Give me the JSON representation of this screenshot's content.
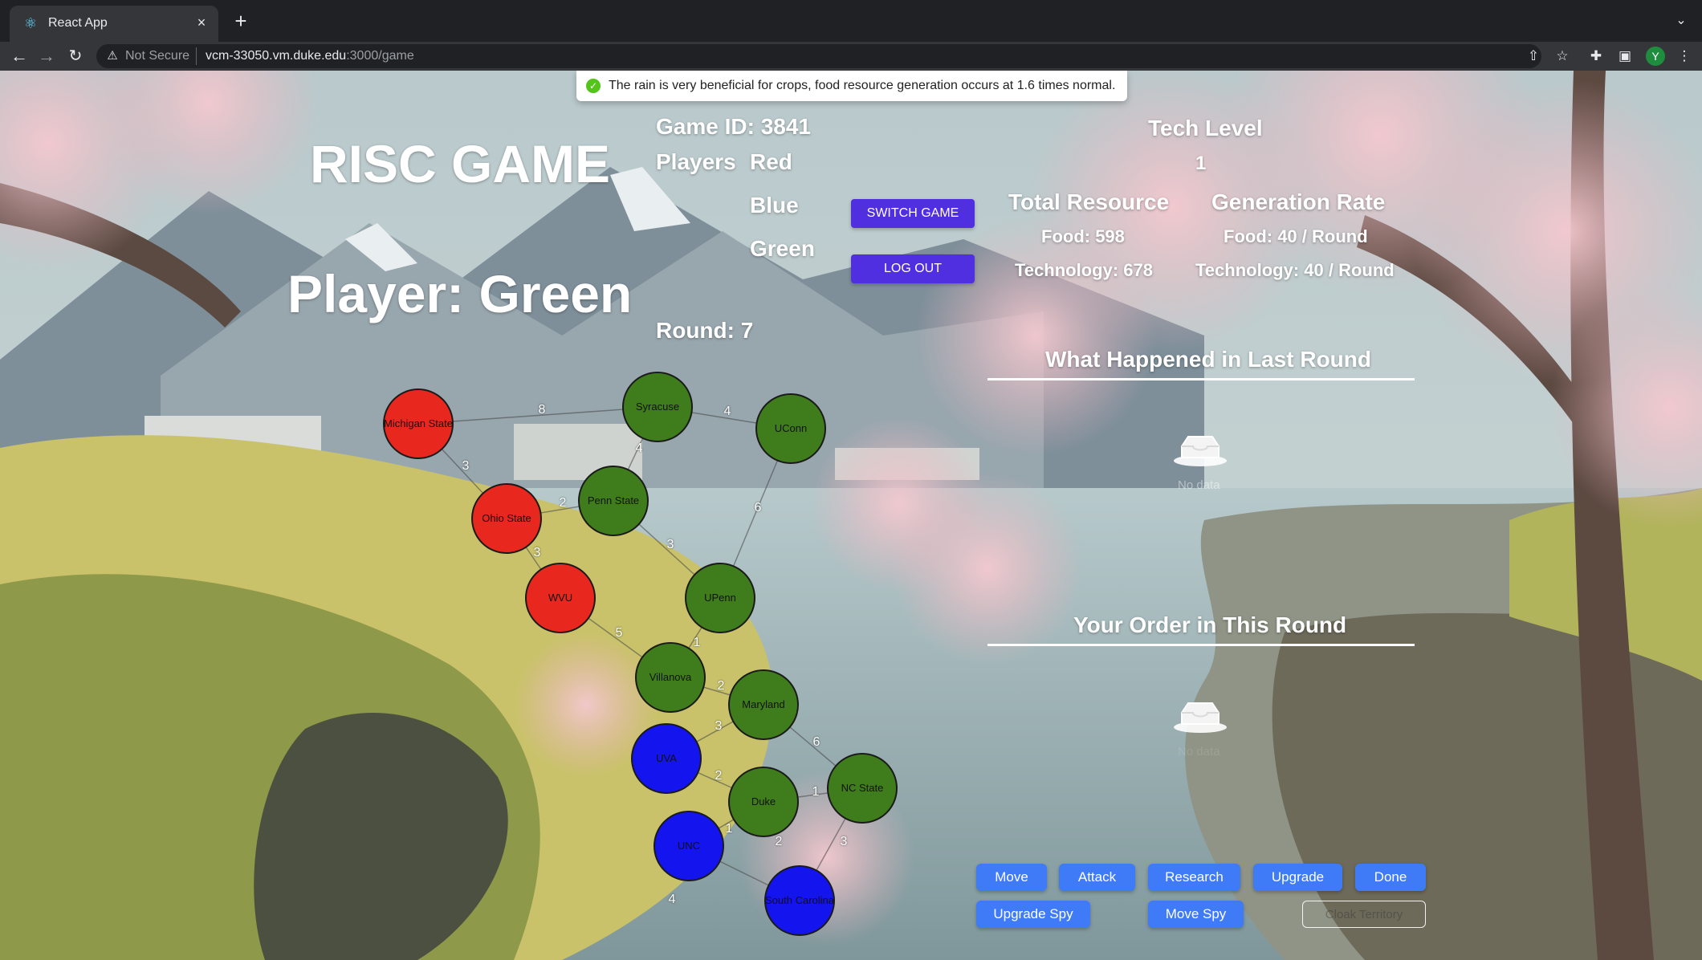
{
  "browser": {
    "tab_title": "React App",
    "tab_close": "×",
    "new_tab": "+",
    "security_label": "Not Secure",
    "url_host": "vcm-33050.vm.duke.edu",
    "url_path": ":3000/game",
    "profile_initial": "Y"
  },
  "toast": {
    "message": "The rain is very beneficial for crops, food resource generation occurs at 1.6 times normal.",
    "status_color": "#52c41a"
  },
  "header": {
    "game_title": "RISC GAME",
    "player_heading": "Player: Green",
    "game_id": "Game ID: 3841",
    "players_label": "Players",
    "players": [
      "Red",
      "Blue",
      "Green"
    ],
    "round": "Round: 7",
    "switch_game_label": "SWITCH GAME",
    "logout_label": "LOG OUT"
  },
  "stats": {
    "tech_level_label": "Tech Level",
    "tech_level_value": "1",
    "total_resource_label": "Total Resource",
    "generation_rate_label": "Generation Rate",
    "food_total": "Food: 598",
    "tech_total": "Technology: 678",
    "food_rate": "Food: 40 / Round",
    "tech_rate": "Technology: 40 / Round"
  },
  "last_round": {
    "title": "What Happened in Last Round",
    "empty_text": "No data"
  },
  "orders": {
    "title": "Your Order in This Round",
    "empty_text": "No data"
  },
  "actions": {
    "move": "Move",
    "attack": "Attack",
    "research": "Research",
    "upgrade": "Upgrade",
    "done": "Done",
    "upgrade_spy": "Upgrade Spy",
    "move_spy": "Move Spy",
    "cloak": "Cloak Territory"
  },
  "colors": {
    "red": "#e8281e",
    "green": "#3f7d1c",
    "blue": "#1414ee",
    "primary_button": "#4f2fe0",
    "action_button": "#3f7bf7"
  },
  "map": {
    "territories": [
      {
        "name": "Michigan State",
        "owner": "red"
      },
      {
        "name": "Syracuse",
        "owner": "green"
      },
      {
        "name": "UConn",
        "owner": "green"
      },
      {
        "name": "Ohio State",
        "owner": "red"
      },
      {
        "name": "Penn State",
        "owner": "green"
      },
      {
        "name": "WVU",
        "owner": "red"
      },
      {
        "name": "UPenn",
        "owner": "green"
      },
      {
        "name": "Villanova",
        "owner": "green"
      },
      {
        "name": "Maryland",
        "owner": "green"
      },
      {
        "name": "UVA",
        "owner": "blue"
      },
      {
        "name": "Duke",
        "owner": "green"
      },
      {
        "name": "NC State",
        "owner": "green"
      },
      {
        "name": "UNC",
        "owner": "blue"
      },
      {
        "name": "South Carolina",
        "owner": "blue"
      }
    ],
    "edges": [
      {
        "a": "Michigan State",
        "b": "Syracuse",
        "cost": "8"
      },
      {
        "a": "Syracuse",
        "b": "UConn",
        "cost": "4"
      },
      {
        "a": "Syracuse",
        "b": "Penn State",
        "cost": "4"
      },
      {
        "a": "Michigan State",
        "b": "Ohio State",
        "cost": "3"
      },
      {
        "a": "Ohio State",
        "b": "Penn State",
        "cost": "2"
      },
      {
        "a": "UConn",
        "b": "UPenn",
        "cost": "6"
      },
      {
        "a": "Penn State",
        "b": "UPenn",
        "cost": "3"
      },
      {
        "a": "Ohio State",
        "b": "WVU",
        "cost": "3"
      },
      {
        "a": "WVU",
        "b": "Villanova",
        "cost": "5"
      },
      {
        "a": "UPenn",
        "b": "Villanova",
        "cost": "1"
      },
      {
        "a": "Villanova",
        "b": "Maryland",
        "cost": "2"
      },
      {
        "a": "Maryland",
        "b": "UVA",
        "cost": "3"
      },
      {
        "a": "Maryland",
        "b": "NC State",
        "cost": "6"
      },
      {
        "a": "UVA",
        "b": "Duke",
        "cost": "2"
      },
      {
        "a": "Duke",
        "b": "NC State",
        "cost": "1"
      },
      {
        "a": "Duke",
        "b": "UNC",
        "cost": "1"
      },
      {
        "a": "UNC",
        "b": "South Carolina",
        "cost": "2"
      },
      {
        "a": "NC State",
        "b": "South Carolina",
        "cost": "3"
      },
      {
        "a": "UNC",
        "b": "South Carolina",
        "cost": "4"
      }
    ]
  }
}
